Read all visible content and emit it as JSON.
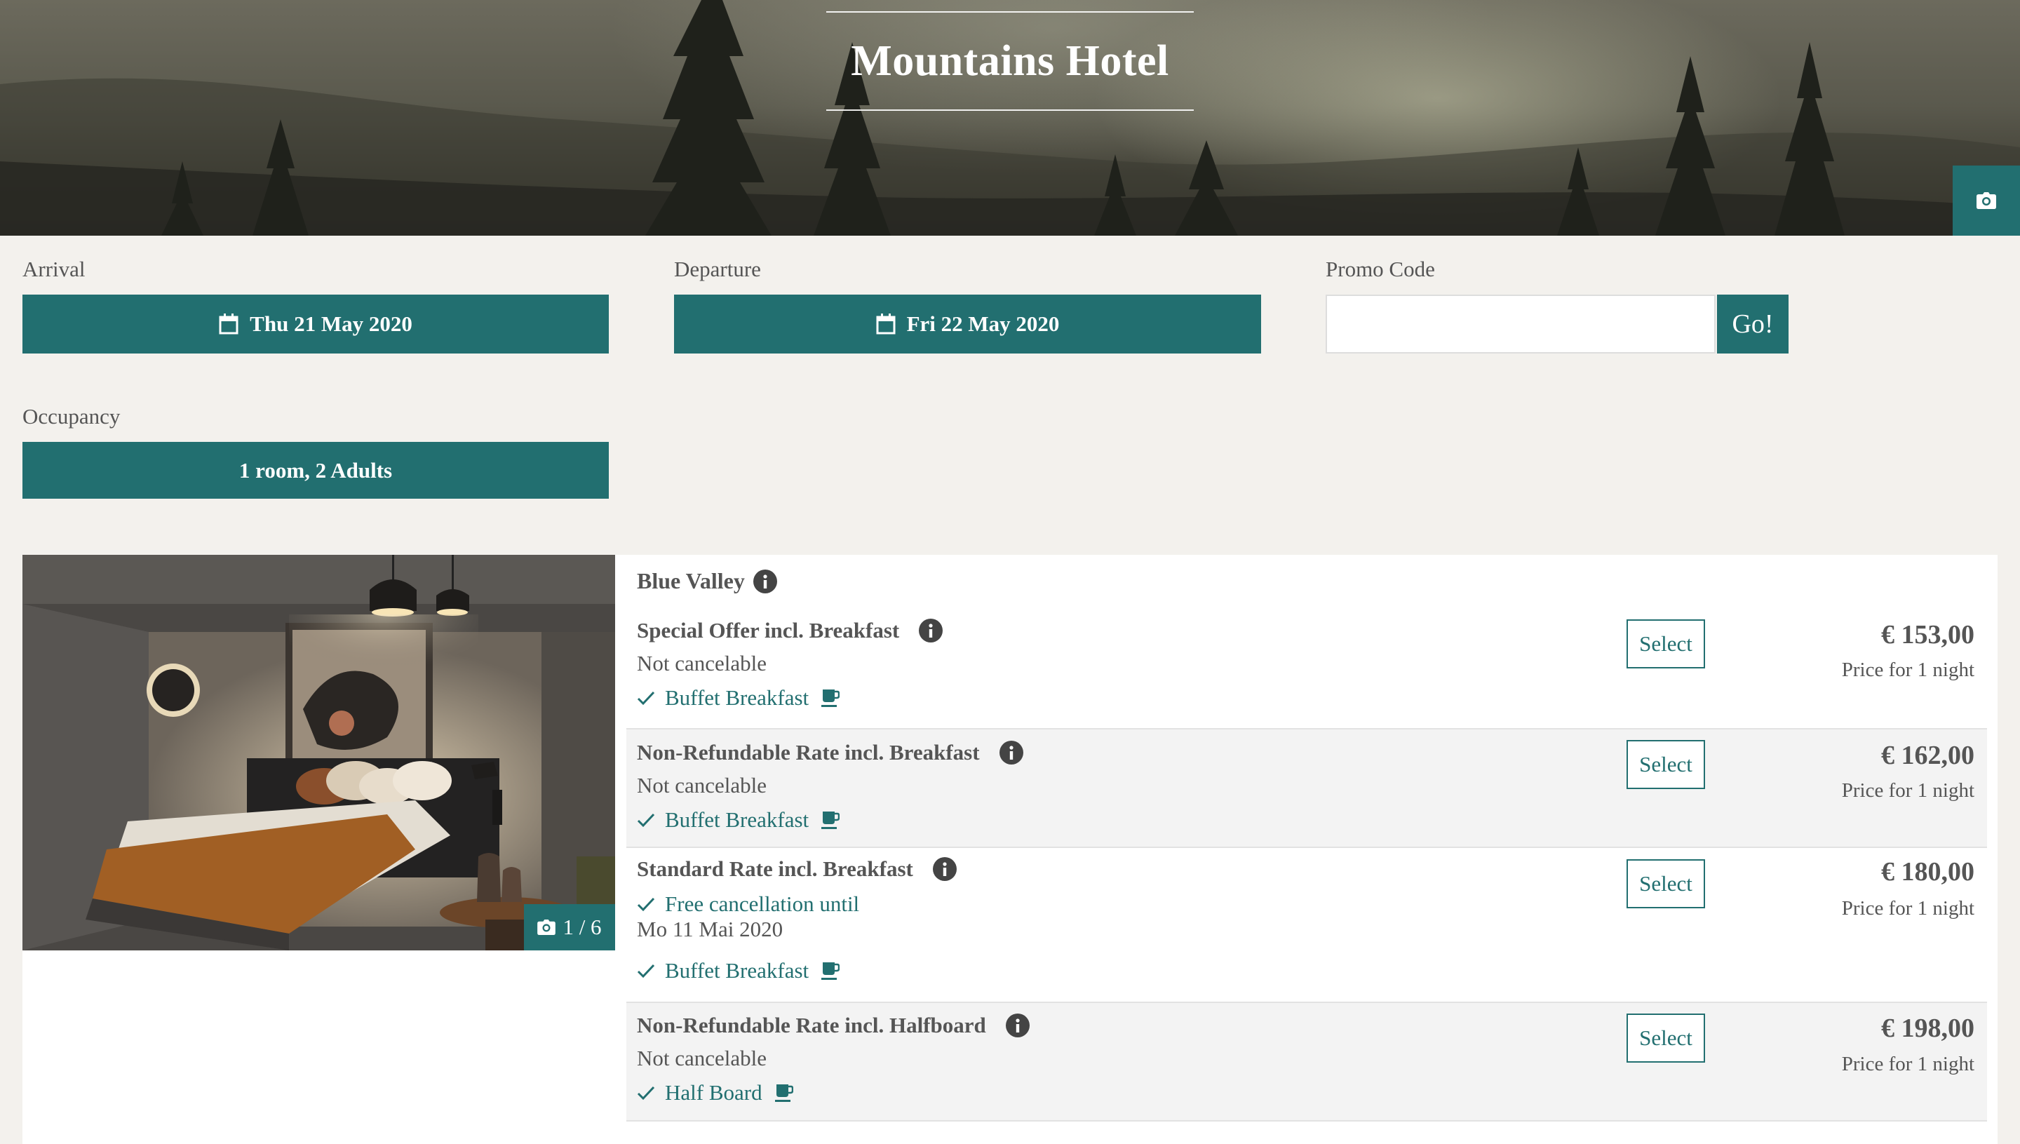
{
  "hotel": {
    "name": "Mountains Hotel"
  },
  "icons": {
    "gallery": "camera-icon",
    "calendar": "calendar-icon",
    "info": "info-icon",
    "check": "check-icon",
    "meal": "coffee-cup-icon"
  },
  "colors": {
    "accent": "#226f70",
    "background": "#f3f1ed",
    "card": "#ffffff",
    "row_alt": "#f3f3f3"
  },
  "search": {
    "arrival_label": "Arrival",
    "arrival_value": "Thu 21 May 2020",
    "departure_label": "Departure",
    "departure_value": "Fri 22 May 2020",
    "promo_label": "Promo Code",
    "promo_value": "",
    "promo_button": "Go!",
    "occupancy_label": "Occupancy",
    "occupancy_value": "1 room, 2 Adults"
  },
  "room": {
    "name": "Blue Valley",
    "photo_counter": "1 / 6",
    "rates": [
      {
        "title": "Special Offer incl. Breakfast",
        "cancellation": "Not cancelable",
        "meal": "Buffet Breakfast",
        "select": "Select",
        "price": "€ 153,00",
        "price_note": "Price for 1 night"
      },
      {
        "title": "Non-Refundable Rate incl. Breakfast",
        "cancellation": "Not cancelable",
        "meal": "Buffet Breakfast",
        "select": "Select",
        "price": "€ 162,00",
        "price_note": "Price for 1 night"
      },
      {
        "title": "Standard Rate incl. Breakfast",
        "cancellation_feature": "Free cancellation until",
        "cancellation_date": "Mo 11 Mai 2020",
        "meal": "Buffet Breakfast",
        "select": "Select",
        "price": "€ 180,00",
        "price_note": "Price for 1 night"
      },
      {
        "title": "Non-Refundable Rate incl. Halfboard",
        "cancellation": "Not cancelable",
        "meal": "Half Board",
        "select": "Select",
        "price": "€ 198,00",
        "price_note": "Price for 1 night"
      }
    ]
  }
}
